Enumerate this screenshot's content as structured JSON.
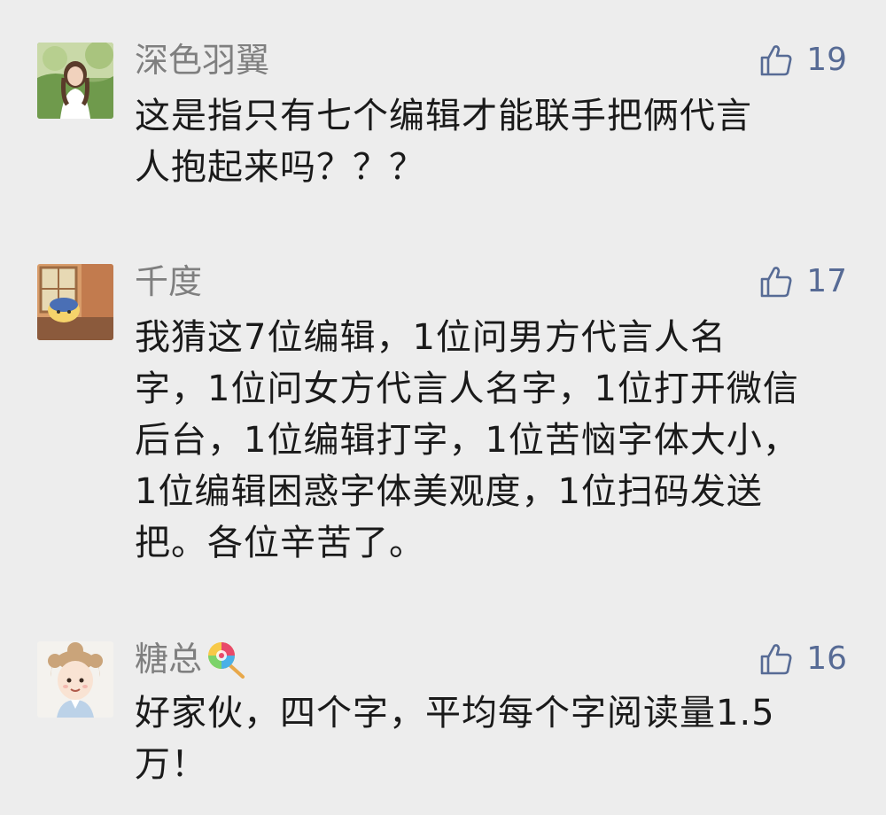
{
  "theme": {
    "background": "#ededed",
    "nickname_color": "#7f7f7f",
    "like_color": "#576b95",
    "text_color": "#1a1a1a"
  },
  "comments": [
    {
      "nickname": "深色羽翼",
      "likes": "19",
      "avatar_icon": "avatar-girl-photo",
      "lines": [
        "这是指只有七个编辑才能联手把俩代言",
        "人抱起来吗？？？"
      ]
    },
    {
      "nickname": "千度",
      "likes": "17",
      "avatar_icon": "avatar-cartoon-window",
      "lines": [
        "我猜这7位编辑，1位问男方代言人名",
        "字，1位问女方代言人名字，1位打开微信",
        "后台，1位编辑打字，1位苦恼字体大小，",
        "1位编辑困惑字体美观度，1位扫码发送",
        "把。各位辛苦了。"
      ]
    },
    {
      "nickname": "糖总",
      "nickname_emoji": "lollipop-emoji",
      "likes": "16",
      "avatar_icon": "avatar-cartoon-boy",
      "lines": [
        "好家伙，四个字，平均每个字阅读量1.5",
        "万！"
      ]
    }
  ]
}
